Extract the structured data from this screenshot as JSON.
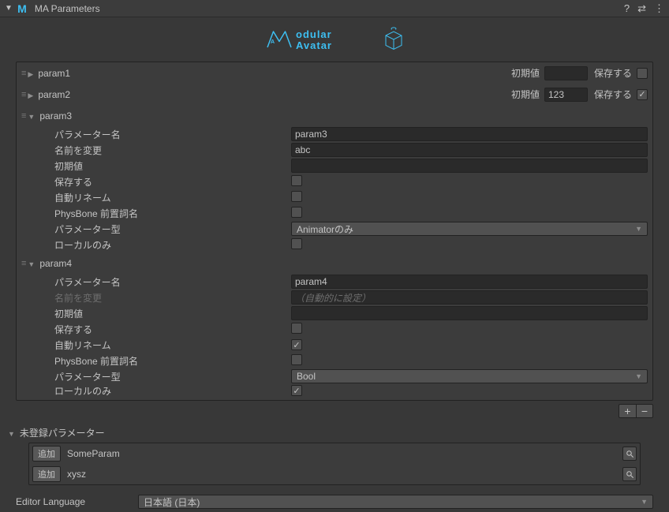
{
  "header": {
    "title": "MA Parameters"
  },
  "params": [
    {
      "name": "param1",
      "expanded": false,
      "inline": {
        "default_label": "初期値",
        "default_value": "",
        "save_label": "保存する",
        "save_checked": false
      }
    },
    {
      "name": "param2",
      "expanded": false,
      "inline": {
        "default_label": "初期値",
        "default_value": "123",
        "save_label": "保存する",
        "save_checked": true
      }
    },
    {
      "name": "param3",
      "expanded": true,
      "details": {
        "param_name_label": "パラメーター名",
        "param_name_value": "param3",
        "rename_label": "名前を変更",
        "rename_value": "abc",
        "rename_dim": false,
        "default_label": "初期値",
        "default_value": "",
        "save_label": "保存する",
        "save_checked": false,
        "auto_rename_label": "自動リネーム",
        "auto_rename_checked": false,
        "physbone_label": "PhysBone 前置詞名",
        "physbone_checked": false,
        "type_label": "パラメーター型",
        "type_value": "Animatorのみ",
        "local_label": "ローカルのみ",
        "local_checked": false
      }
    },
    {
      "name": "param4",
      "expanded": true,
      "details": {
        "param_name_label": "パラメーター名",
        "param_name_value": "param4",
        "rename_label": "名前を変更",
        "rename_value": "（自動的に設定）",
        "rename_dim": true,
        "default_label": "初期値",
        "default_value": "",
        "save_label": "保存する",
        "save_checked": false,
        "auto_rename_label": "自動リネーム",
        "auto_rename_checked": true,
        "physbone_label": "PhysBone 前置詞名",
        "physbone_checked": false,
        "type_label": "パラメーター型",
        "type_value": "Bool",
        "local_label": "ローカルのみ",
        "local_checked": true
      }
    }
  ],
  "unregistered": {
    "title": "未登録パラメーター",
    "add_label": "追加",
    "items": [
      {
        "name": "SomeParam"
      },
      {
        "name": "xysz"
      }
    ]
  },
  "language": {
    "label": "Editor Language",
    "value": "日本語 (日本)"
  }
}
